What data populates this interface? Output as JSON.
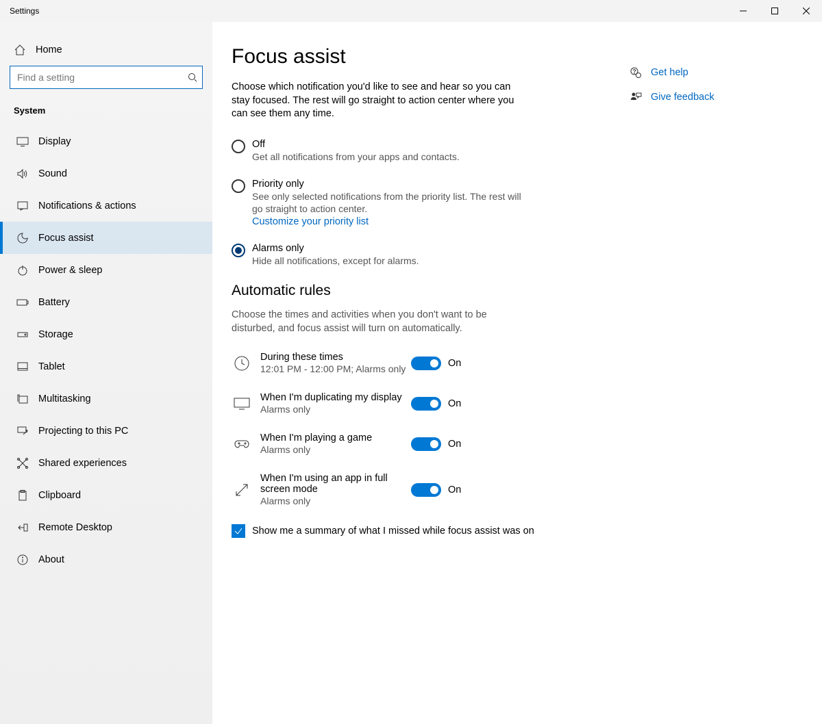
{
  "window": {
    "title": "Settings"
  },
  "sidebar": {
    "home": "Home",
    "search_placeholder": "Find a setting",
    "section": "System",
    "items": [
      {
        "label": "Display"
      },
      {
        "label": "Sound"
      },
      {
        "label": "Notifications & actions"
      },
      {
        "label": "Focus assist"
      },
      {
        "label": "Power & sleep"
      },
      {
        "label": "Battery"
      },
      {
        "label": "Storage"
      },
      {
        "label": "Tablet"
      },
      {
        "label": "Multitasking"
      },
      {
        "label": "Projecting to this PC"
      },
      {
        "label": "Shared experiences"
      },
      {
        "label": "Clipboard"
      },
      {
        "label": "Remote Desktop"
      },
      {
        "label": "About"
      }
    ]
  },
  "page": {
    "title": "Focus assist",
    "description": "Choose which notification you'd like to see and hear so you can stay focused. The rest will go straight to action center where you can see them any time.",
    "radios": {
      "off": {
        "title": "Off",
        "desc": "Get all notifications from your apps and contacts."
      },
      "priority": {
        "title": "Priority only",
        "desc": "See only selected notifications from the priority list. The rest will go straight to action center.",
        "link": "Customize your priority list"
      },
      "alarms": {
        "title": "Alarms only",
        "desc": "Hide all notifications, except for alarms."
      }
    },
    "selected_radio": "alarms",
    "rules": {
      "heading": "Automatic rules",
      "desc": "Choose the times and activities when you don't want to be disturbed, and focus assist will turn on automatically.",
      "items": [
        {
          "title": "During these times",
          "sub": "12:01 PM - 12:00 PM; Alarms only",
          "state": "On"
        },
        {
          "title": "When I'm duplicating my display",
          "sub": "Alarms only",
          "state": "On"
        },
        {
          "title": "When I'm playing a game",
          "sub": "Alarms only",
          "state": "On"
        },
        {
          "title": "When I'm using an app in full screen mode",
          "sub": "Alarms only",
          "state": "On"
        }
      ]
    },
    "summary_checkbox": {
      "label": "Show me a summary of what I missed while focus assist was on",
      "checked": true
    }
  },
  "right": {
    "help": "Get help",
    "feedback": "Give feedback"
  }
}
